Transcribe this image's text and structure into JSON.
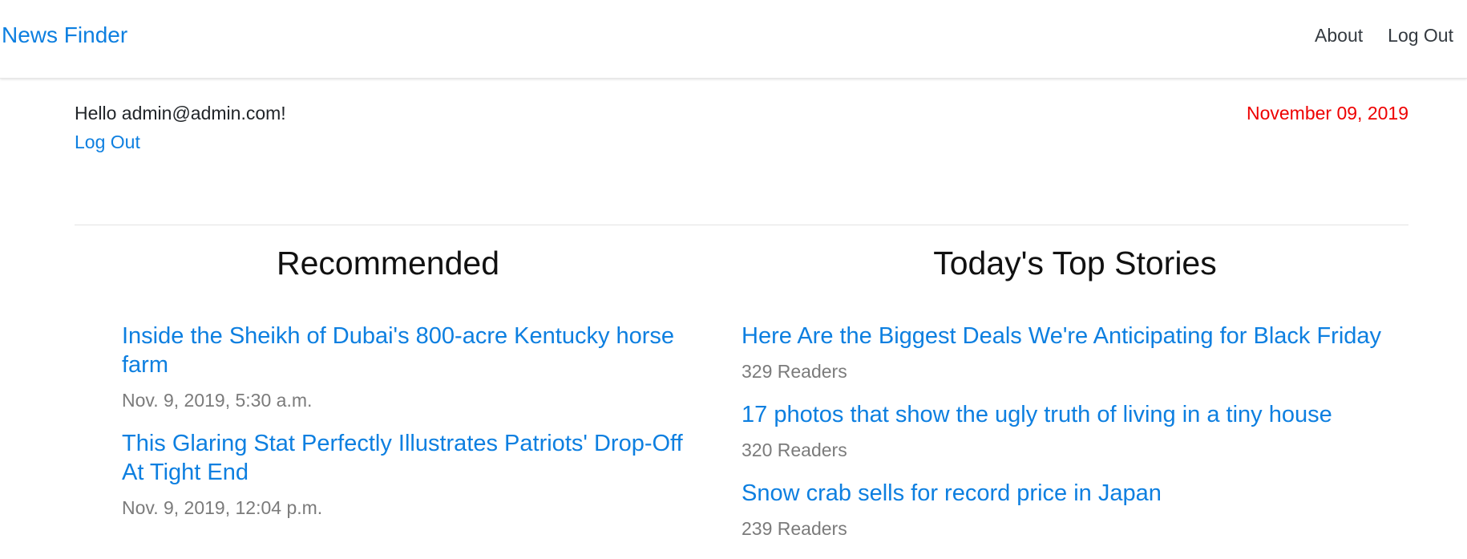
{
  "navbar": {
    "brand": "News Finder",
    "links": [
      "About",
      "Log Out"
    ]
  },
  "user": {
    "greeting": "Hello admin@admin.com!",
    "logout_label": "Log Out"
  },
  "date": "November 09, 2019",
  "recommended": {
    "heading": "Recommended",
    "items": [
      {
        "title": "Inside the Sheikh of Dubai's 800-acre Kentucky horse farm",
        "meta": "Nov. 9, 2019, 5:30 a.m."
      },
      {
        "title": "This Glaring Stat Perfectly Illustrates Patriots' Drop-Off At Tight End",
        "meta": "Nov. 9, 2019, 12:04 p.m."
      }
    ]
  },
  "top_stories": {
    "heading": "Today's Top Stories",
    "items": [
      {
        "title": "Here Are the Biggest Deals We're Anticipating for Black Friday",
        "meta": "329 Readers"
      },
      {
        "title": "17 photos that show the ugly truth of living in a tiny house",
        "meta": "320 Readers"
      },
      {
        "title": "Snow crab sells for record price in Japan",
        "meta": "239 Readers"
      }
    ]
  },
  "colors": {
    "link_blue": "#0d7fe0",
    "date_red": "#ee0000",
    "meta_gray": "#7b7b7b"
  }
}
